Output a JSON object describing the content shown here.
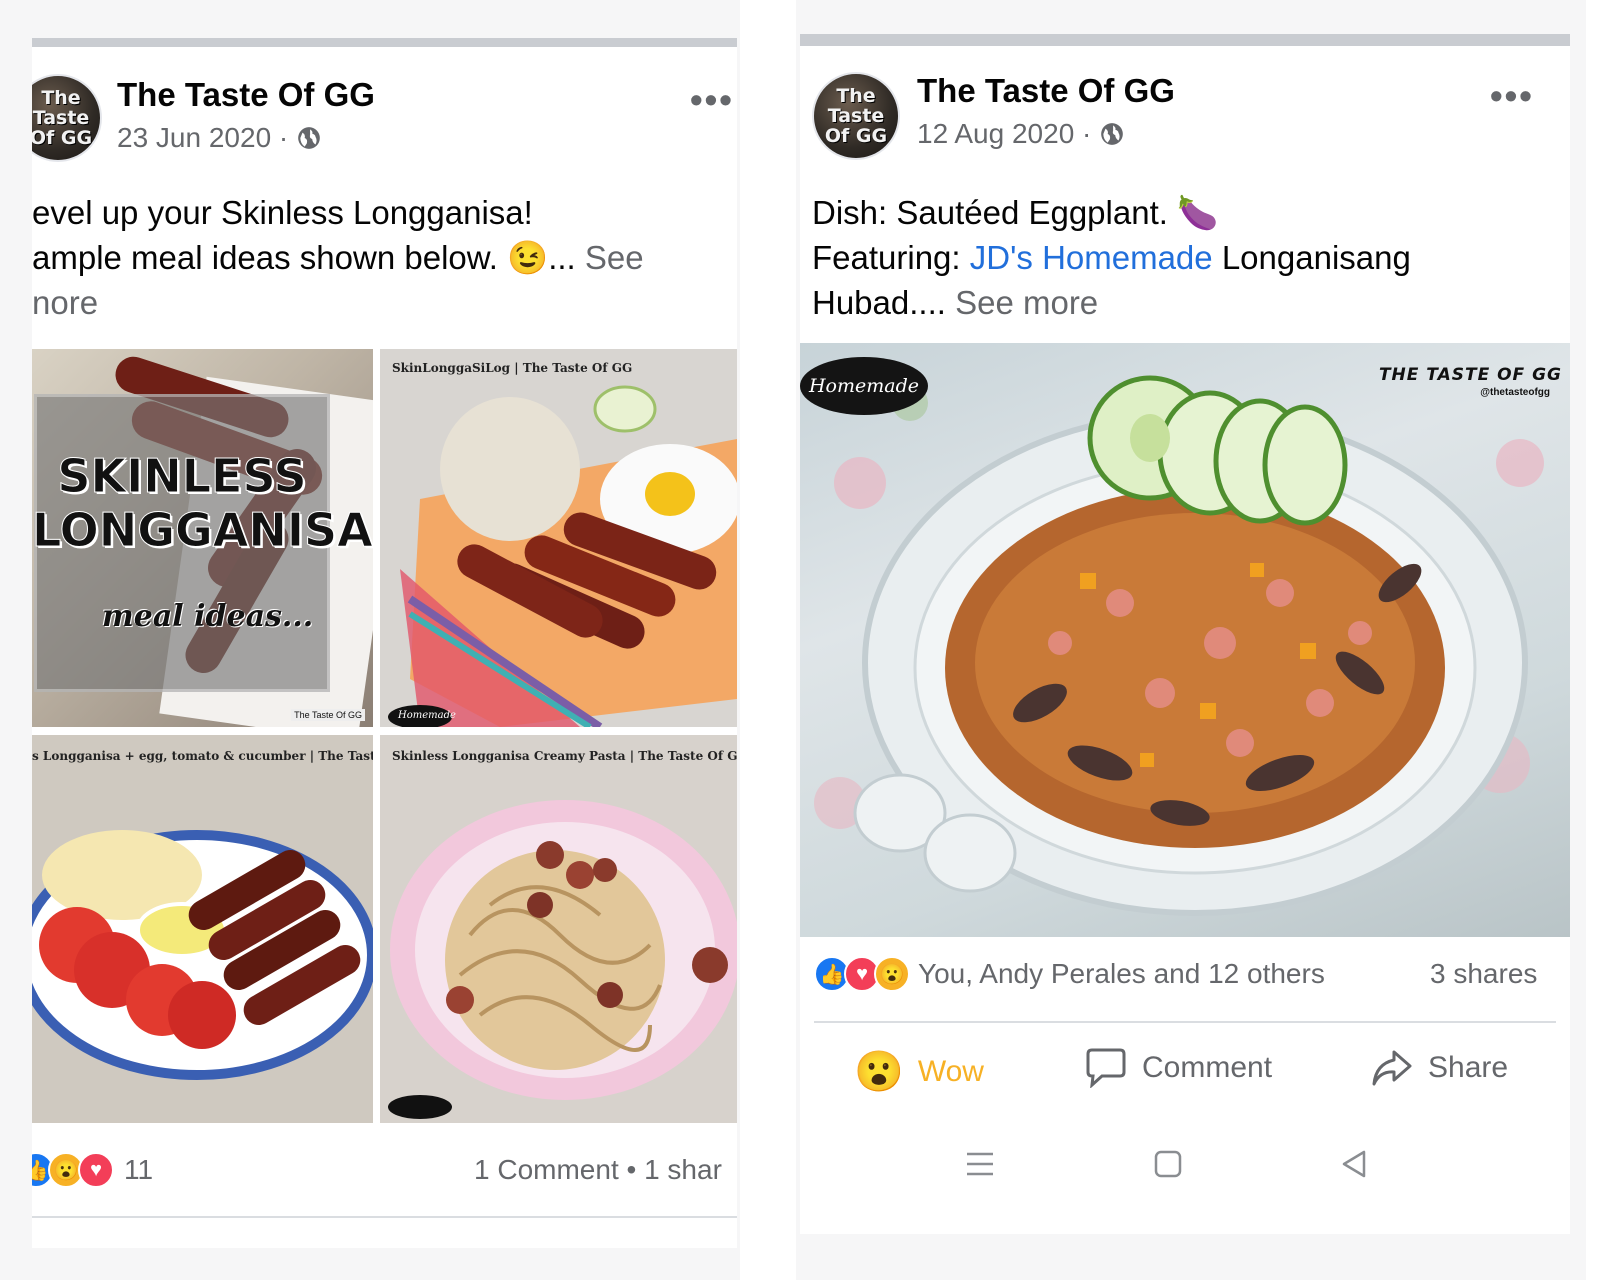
{
  "left_post": {
    "avatar_text": "The Taste Of GG",
    "page_name": "The Taste Of GG",
    "date": "23 Jun 2020 ·",
    "text_line1": "evel up your Skinless Longganisa!",
    "text_line2": "ample meal ideas shown below. 😉...",
    "see_more_a": "See",
    "see_more_b": "nore",
    "photos": {
      "p1_title_1": "SKINLESS",
      "p1_title_2": "LONGGANISA",
      "p1_sub": "meal ideas...",
      "p2_label": "SkinLonggaSiLog | The Taste Of GG",
      "p3_label": "s Longganisa + egg, tomato & cucumber | The Taste Of GG",
      "p4_label": "Skinless Longganisa Creamy Pasta | The Taste Of GG",
      "watermark": "The Taste Of GG",
      "homemade": "Homemade"
    },
    "reaction_count": "11",
    "comments_shares": "1 Comment • 1 shar"
  },
  "right_post": {
    "avatar_text": "The Taste Of GG",
    "page_name": "The Taste Of GG",
    "date": "12 Aug 2020 ·",
    "text_line1": "Dish: Sautéed Eggplant. 🍆",
    "text_line2_a": "Featuring:",
    "text_line2_link": "JD's Homemade",
    "text_line2_b": "Longanisang",
    "text_line3": "Hubad....",
    "see_more": "See more",
    "photo": {
      "badge": "Homemade",
      "brand": "THE TASTE OF GG",
      "handle": "@thetasteofgg"
    },
    "reactions_text": "You, Andy Perales and 12 others",
    "shares": "3 shares",
    "actions": {
      "wow": "Wow",
      "comment": "Comment",
      "share": "Share"
    }
  },
  "icons": [
    "globe-icon",
    "more-icon",
    "like-icon",
    "love-icon",
    "wow-icon",
    "comment-icon",
    "share-icon",
    "menu-icon",
    "home-square-icon",
    "back-icon"
  ],
  "colors": {
    "link": "#216fdb",
    "wow": "#f7b125",
    "like": "#1877f2",
    "love": "#f33e58",
    "secondary_text": "#65676b"
  }
}
